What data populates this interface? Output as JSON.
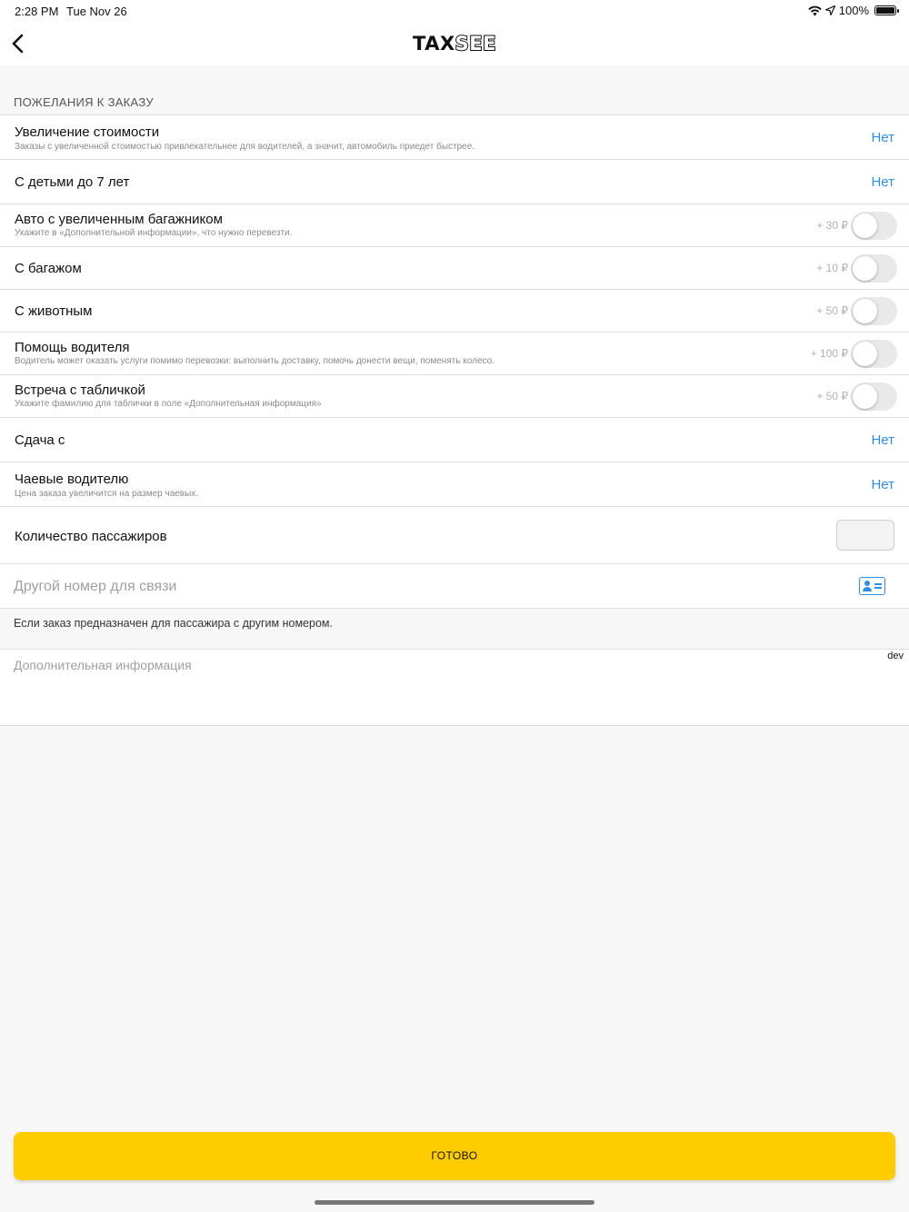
{
  "status_bar": {
    "time": "2:28 PM",
    "date": "Tue Nov 26",
    "battery": "100%"
  },
  "navbar": {
    "logo_part1": "TAX",
    "logo_part2": "SEE"
  },
  "section_header": "ПОЖЕЛАНИЯ К ЗАКАЗУ",
  "options": [
    {
      "title": "Увеличение стоимости",
      "subtitle": "Заказы с увеличенной стоимостью привлекательнее для водителей, а значит, автомобиль приедет быстрее.",
      "value": "Нет"
    },
    {
      "title": "С детьми до 7 лет",
      "value": "Нет"
    },
    {
      "title": "Авто с увеличенным багажником",
      "subtitle": "Укажите в «Дополнительной информации», что нужно перевезти.",
      "price": "+ 30 ₽",
      "enabled": false
    },
    {
      "title": "С багажом",
      "price": "+ 10 ₽",
      "enabled": false
    },
    {
      "title": "С животным",
      "price": "+ 50 ₽",
      "enabled": false
    },
    {
      "title": "Помощь водителя",
      "subtitle": "Водитель может оказать услуги помимо перевозки: выполнить доставку, помочь донести вещи, поменять колесо.",
      "price": "+ 100 ₽",
      "enabled": false
    },
    {
      "title": "Встреча с табличкой",
      "subtitle": "Укажите фамилию для таблички в поле «Дополнительная информация»",
      "price": "+ 50 ₽",
      "enabled": false
    },
    {
      "title": "Сдача с",
      "value": "Нет"
    },
    {
      "title": "Чаевые водителю",
      "subtitle": "Цена заказа увеличится на размер чаевых.",
      "value": "Нет"
    },
    {
      "title": "Количество пассажиров"
    }
  ],
  "phone": {
    "placeholder": "Другой номер для связи",
    "hint": "Если заказ предназначен для пассажира с другим номером."
  },
  "extra_info": {
    "placeholder": "Дополнительная информация",
    "badge": "dev"
  },
  "done_button": "ГОТОВО",
  "colors": {
    "accent_blue": "#2f8ee0",
    "button_yellow": "#ffcc00"
  }
}
